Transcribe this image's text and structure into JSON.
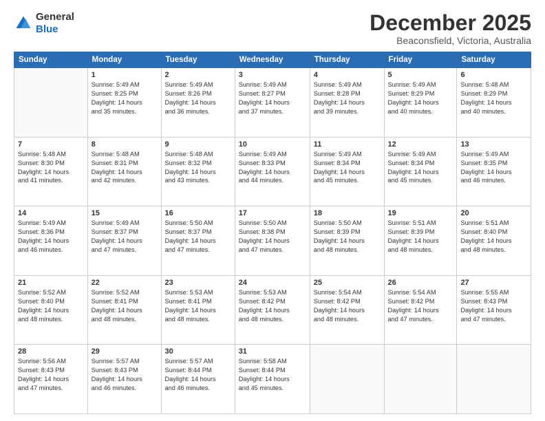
{
  "logo": {
    "general": "General",
    "blue": "Blue"
  },
  "header": {
    "month": "December 2025",
    "location": "Beaconsfield, Victoria, Australia"
  },
  "weekdays": [
    "Sunday",
    "Monday",
    "Tuesday",
    "Wednesday",
    "Thursday",
    "Friday",
    "Saturday"
  ],
  "weeks": [
    [
      {
        "day": "",
        "info": ""
      },
      {
        "day": "1",
        "info": "Sunrise: 5:49 AM\nSunset: 8:25 PM\nDaylight: 14 hours\nand 35 minutes."
      },
      {
        "day": "2",
        "info": "Sunrise: 5:49 AM\nSunset: 8:26 PM\nDaylight: 14 hours\nand 36 minutes."
      },
      {
        "day": "3",
        "info": "Sunrise: 5:49 AM\nSunset: 8:27 PM\nDaylight: 14 hours\nand 37 minutes."
      },
      {
        "day": "4",
        "info": "Sunrise: 5:49 AM\nSunset: 8:28 PM\nDaylight: 14 hours\nand 39 minutes."
      },
      {
        "day": "5",
        "info": "Sunrise: 5:49 AM\nSunset: 8:29 PM\nDaylight: 14 hours\nand 40 minutes."
      },
      {
        "day": "6",
        "info": "Sunrise: 5:48 AM\nSunset: 8:29 PM\nDaylight: 14 hours\nand 40 minutes."
      }
    ],
    [
      {
        "day": "7",
        "info": "Sunrise: 5:48 AM\nSunset: 8:30 PM\nDaylight: 14 hours\nand 41 minutes."
      },
      {
        "day": "8",
        "info": "Sunrise: 5:48 AM\nSunset: 8:31 PM\nDaylight: 14 hours\nand 42 minutes."
      },
      {
        "day": "9",
        "info": "Sunrise: 5:48 AM\nSunset: 8:32 PM\nDaylight: 14 hours\nand 43 minutes."
      },
      {
        "day": "10",
        "info": "Sunrise: 5:49 AM\nSunset: 8:33 PM\nDaylight: 14 hours\nand 44 minutes."
      },
      {
        "day": "11",
        "info": "Sunrise: 5:49 AM\nSunset: 8:34 PM\nDaylight: 14 hours\nand 45 minutes."
      },
      {
        "day": "12",
        "info": "Sunrise: 5:49 AM\nSunset: 8:34 PM\nDaylight: 14 hours\nand 45 minutes."
      },
      {
        "day": "13",
        "info": "Sunrise: 5:49 AM\nSunset: 8:35 PM\nDaylight: 14 hours\nand 46 minutes."
      }
    ],
    [
      {
        "day": "14",
        "info": "Sunrise: 5:49 AM\nSunset: 8:36 PM\nDaylight: 14 hours\nand 46 minutes."
      },
      {
        "day": "15",
        "info": "Sunrise: 5:49 AM\nSunset: 8:37 PM\nDaylight: 14 hours\nand 47 minutes."
      },
      {
        "day": "16",
        "info": "Sunrise: 5:50 AM\nSunset: 8:37 PM\nDaylight: 14 hours\nand 47 minutes."
      },
      {
        "day": "17",
        "info": "Sunrise: 5:50 AM\nSunset: 8:38 PM\nDaylight: 14 hours\nand 47 minutes."
      },
      {
        "day": "18",
        "info": "Sunrise: 5:50 AM\nSunset: 8:39 PM\nDaylight: 14 hours\nand 48 minutes."
      },
      {
        "day": "19",
        "info": "Sunrise: 5:51 AM\nSunset: 8:39 PM\nDaylight: 14 hours\nand 48 minutes."
      },
      {
        "day": "20",
        "info": "Sunrise: 5:51 AM\nSunset: 8:40 PM\nDaylight: 14 hours\nand 48 minutes."
      }
    ],
    [
      {
        "day": "21",
        "info": "Sunrise: 5:52 AM\nSunset: 8:40 PM\nDaylight: 14 hours\nand 48 minutes."
      },
      {
        "day": "22",
        "info": "Sunrise: 5:52 AM\nSunset: 8:41 PM\nDaylight: 14 hours\nand 48 minutes."
      },
      {
        "day": "23",
        "info": "Sunrise: 5:53 AM\nSunset: 8:41 PM\nDaylight: 14 hours\nand 48 minutes."
      },
      {
        "day": "24",
        "info": "Sunrise: 5:53 AM\nSunset: 8:42 PM\nDaylight: 14 hours\nand 48 minutes."
      },
      {
        "day": "25",
        "info": "Sunrise: 5:54 AM\nSunset: 8:42 PM\nDaylight: 14 hours\nand 48 minutes."
      },
      {
        "day": "26",
        "info": "Sunrise: 5:54 AM\nSunset: 8:42 PM\nDaylight: 14 hours\nand 47 minutes."
      },
      {
        "day": "27",
        "info": "Sunrise: 5:55 AM\nSunset: 8:43 PM\nDaylight: 14 hours\nand 47 minutes."
      }
    ],
    [
      {
        "day": "28",
        "info": "Sunrise: 5:56 AM\nSunset: 8:43 PM\nDaylight: 14 hours\nand 47 minutes."
      },
      {
        "day": "29",
        "info": "Sunrise: 5:57 AM\nSunset: 8:43 PM\nDaylight: 14 hours\nand 46 minutes."
      },
      {
        "day": "30",
        "info": "Sunrise: 5:57 AM\nSunset: 8:44 PM\nDaylight: 14 hours\nand 46 minutes."
      },
      {
        "day": "31",
        "info": "Sunrise: 5:58 AM\nSunset: 8:44 PM\nDaylight: 14 hours\nand 45 minutes."
      },
      {
        "day": "",
        "info": ""
      },
      {
        "day": "",
        "info": ""
      },
      {
        "day": "",
        "info": ""
      }
    ]
  ]
}
